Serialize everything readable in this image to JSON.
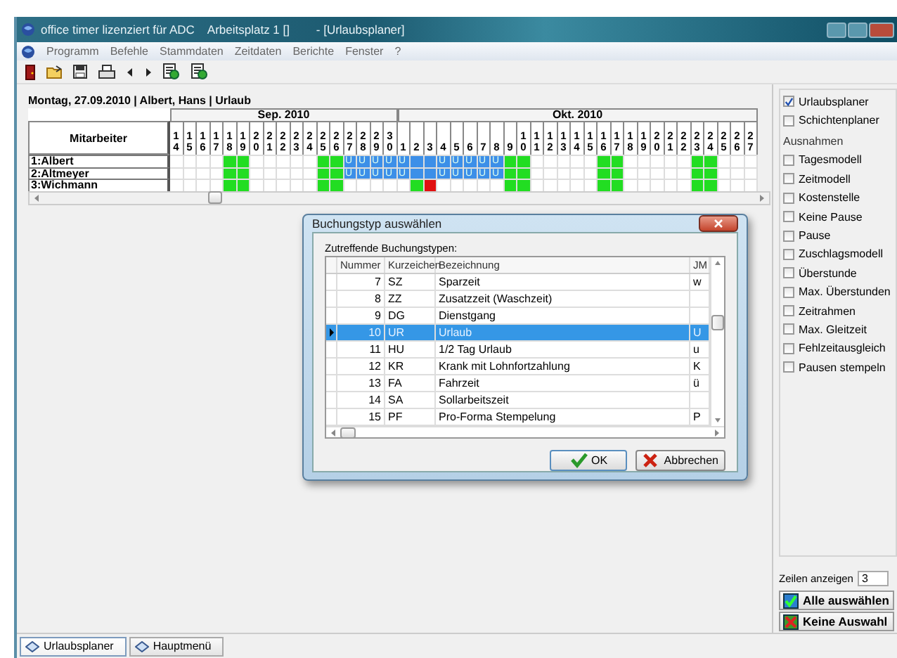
{
  "window": {
    "title": "office timer lizenziert für ADC    Arbeitsplatz 1 []        - [Urlaubsplaner]"
  },
  "menu": [
    "Programm",
    "Befehle",
    "Stammdaten",
    "Zeitdaten",
    "Berichte",
    "Fenster",
    "?"
  ],
  "planner": {
    "header": "Montag, 27.09.2010 | Albert, Hans | Urlaub",
    "employee_column": "Mitarbeiter",
    "months": [
      {
        "label": "Sep. 2010",
        "days": [
          "14",
          "15",
          "16",
          "17",
          "18",
          "19",
          "20",
          "21",
          "22",
          "23",
          "24",
          "25",
          "26",
          "27",
          "28",
          "29",
          "30"
        ]
      },
      {
        "label": "Okt. 2010",
        "days": [
          "1",
          "2",
          "3",
          "4",
          "5",
          "6",
          "7",
          "8",
          "9",
          "10",
          "11",
          "12",
          "13",
          "14",
          "15",
          "16",
          "17",
          "18",
          "19",
          "20",
          "21",
          "22",
          "23",
          "24",
          "25",
          "26",
          "27"
        ]
      }
    ],
    "rows": [
      {
        "name": "1:Albert",
        "cells": [
          {
            "kind": "empty"
          },
          {
            "kind": "empty"
          },
          {
            "kind": "empty"
          },
          {
            "kind": "empty"
          },
          {
            "kind": "weekend"
          },
          {
            "kind": "weekend"
          },
          {
            "kind": "empty"
          },
          {
            "kind": "empty"
          },
          {
            "kind": "empty"
          },
          {
            "kind": "empty"
          },
          {
            "kind": "empty"
          },
          {
            "kind": "weekend"
          },
          {
            "kind": "weekend"
          },
          {
            "kind": "vacation",
            "text": "U"
          },
          {
            "kind": "vacation",
            "text": "U"
          },
          {
            "kind": "vacation",
            "text": "U"
          },
          {
            "kind": "vacation",
            "text": "U"
          },
          {
            "kind": "vacation",
            "text": "U"
          },
          {
            "kind": "vacation"
          },
          {
            "kind": "vacation"
          },
          {
            "kind": "vacation",
            "text": "U"
          },
          {
            "kind": "vacation",
            "text": "U"
          },
          {
            "kind": "vacation",
            "text": "U"
          },
          {
            "kind": "vacation",
            "text": "U"
          },
          {
            "kind": "vacation",
            "text": "U"
          },
          {
            "kind": "weekend"
          },
          {
            "kind": "weekend"
          },
          {
            "kind": "empty"
          },
          {
            "kind": "empty"
          },
          {
            "kind": "empty"
          },
          {
            "kind": "empty"
          },
          {
            "kind": "empty"
          },
          {
            "kind": "weekend"
          },
          {
            "kind": "weekend"
          },
          {
            "kind": "empty"
          },
          {
            "kind": "empty"
          },
          {
            "kind": "empty"
          },
          {
            "kind": "empty"
          },
          {
            "kind": "empty"
          },
          {
            "kind": "weekend"
          },
          {
            "kind": "weekend"
          },
          {
            "kind": "empty"
          },
          {
            "kind": "empty"
          },
          {
            "kind": "empty"
          }
        ]
      },
      {
        "name": "2:Altmeyer",
        "cells": [
          {
            "kind": "empty"
          },
          {
            "kind": "empty"
          },
          {
            "kind": "empty"
          },
          {
            "kind": "empty"
          },
          {
            "kind": "weekend"
          },
          {
            "kind": "weekend"
          },
          {
            "kind": "empty"
          },
          {
            "kind": "empty"
          },
          {
            "kind": "empty"
          },
          {
            "kind": "empty"
          },
          {
            "kind": "empty"
          },
          {
            "kind": "weekend"
          },
          {
            "kind": "weekend"
          },
          {
            "kind": "vacation",
            "text": "U"
          },
          {
            "kind": "vacation",
            "text": "U"
          },
          {
            "kind": "vacation",
            "text": "U"
          },
          {
            "kind": "vacation",
            "text": "U"
          },
          {
            "kind": "vacation",
            "text": "U"
          },
          {
            "kind": "vacation"
          },
          {
            "kind": "vacation"
          },
          {
            "kind": "vacation",
            "text": "U"
          },
          {
            "kind": "vacation",
            "text": "U"
          },
          {
            "kind": "vacation",
            "text": "U"
          },
          {
            "kind": "vacation",
            "text": "U"
          },
          {
            "kind": "vacation",
            "text": "U"
          },
          {
            "kind": "weekend"
          },
          {
            "kind": "weekend"
          },
          {
            "kind": "empty"
          },
          {
            "kind": "empty"
          },
          {
            "kind": "empty"
          },
          {
            "kind": "empty"
          },
          {
            "kind": "empty"
          },
          {
            "kind": "weekend"
          },
          {
            "kind": "weekend"
          },
          {
            "kind": "empty"
          },
          {
            "kind": "empty"
          },
          {
            "kind": "empty"
          },
          {
            "kind": "empty"
          },
          {
            "kind": "empty"
          },
          {
            "kind": "weekend"
          },
          {
            "kind": "weekend"
          },
          {
            "kind": "empty"
          },
          {
            "kind": "empty"
          },
          {
            "kind": "empty"
          }
        ]
      },
      {
        "name": "3:Wichmann",
        "cells": [
          {
            "kind": "empty"
          },
          {
            "kind": "empty"
          },
          {
            "kind": "empty"
          },
          {
            "kind": "empty"
          },
          {
            "kind": "weekend"
          },
          {
            "kind": "weekend"
          },
          {
            "kind": "empty"
          },
          {
            "kind": "empty"
          },
          {
            "kind": "empty"
          },
          {
            "kind": "empty"
          },
          {
            "kind": "empty"
          },
          {
            "kind": "weekend"
          },
          {
            "kind": "weekend"
          },
          {
            "kind": "empty"
          },
          {
            "kind": "empty"
          },
          {
            "kind": "empty"
          },
          {
            "kind": "empty"
          },
          {
            "kind": "empty"
          },
          {
            "kind": "weekend"
          },
          {
            "kind": "flag"
          },
          {
            "kind": "empty"
          },
          {
            "kind": "empty"
          },
          {
            "kind": "empty"
          },
          {
            "kind": "empty"
          },
          {
            "kind": "empty"
          },
          {
            "kind": "weekend"
          },
          {
            "kind": "weekend"
          },
          {
            "kind": "empty"
          },
          {
            "kind": "empty"
          },
          {
            "kind": "empty"
          },
          {
            "kind": "empty"
          },
          {
            "kind": "empty"
          },
          {
            "kind": "weekend"
          },
          {
            "kind": "weekend"
          },
          {
            "kind": "empty"
          },
          {
            "kind": "empty"
          },
          {
            "kind": "empty"
          },
          {
            "kind": "empty"
          },
          {
            "kind": "empty"
          },
          {
            "kind": "weekend"
          },
          {
            "kind": "weekend"
          },
          {
            "kind": "empty"
          },
          {
            "kind": "empty"
          },
          {
            "kind": "empty"
          }
        ]
      }
    ]
  },
  "planners": [
    {
      "label": "Urlaubsplaner",
      "checked": true
    },
    {
      "label": "Schichtenplaner",
      "checked": false
    }
  ],
  "exceptions": {
    "label": "Ausnahmen",
    "items": [
      {
        "label": "Tagesmodell",
        "checked": false
      },
      {
        "label": "Zeitmodell",
        "checked": false
      },
      {
        "label": "Kostenstelle",
        "checked": false
      },
      {
        "label": "Keine Pause",
        "checked": false
      },
      {
        "label": "Pause",
        "checked": false
      },
      {
        "label": "Zuschlagsmodell",
        "checked": false
      },
      {
        "label": "Überstunde",
        "checked": false
      },
      {
        "label": "Max. Überstunden",
        "checked": false
      },
      {
        "label": "Zeitrahmen",
        "checked": false
      },
      {
        "label": "Max. Gleitzeit",
        "checked": false
      },
      {
        "label": "Fehlzeitausgleich",
        "checked": false
      },
      {
        "label": "Pausen stempeln",
        "checked": false
      }
    ]
  },
  "rows_shown": {
    "label": "Zeilen anzeigen",
    "value": "3"
  },
  "select_buttons": [
    {
      "label": "Alle auswählen",
      "kind": "all"
    },
    {
      "label": "Keine Auswahl",
      "kind": "none"
    }
  ],
  "dialog": {
    "title": "Buchungstyp auswählen",
    "list_label": "Zutreffende Buchungstypen:",
    "columns": [
      "Nummer",
      "Kurzeichen",
      "Bezeichnung",
      "JM"
    ],
    "rows": [
      {
        "number": "7",
        "code": "SZ",
        "name": "Sparzeit",
        "jm": "w",
        "selected": false
      },
      {
        "number": "8",
        "code": "ZZ",
        "name": "Zusatzzeit (Waschzeit)",
        "selected": false
      },
      {
        "number": "9",
        "code": "DG",
        "name": "Dienstgang",
        "selected": false
      },
      {
        "number": "10",
        "code": "UR",
        "name": "Urlaub",
        "jm": "U",
        "selected": true
      },
      {
        "number": "11",
        "code": "HU",
        "name": "1/2 Tag Urlaub",
        "jm": "u",
        "selected": false
      },
      {
        "number": "12",
        "code": "KR",
        "name": "Krank mit Lohnfortzahlung",
        "jm": "K",
        "selected": false
      },
      {
        "number": "13",
        "code": "FA",
        "name": "Fahrzeit",
        "jm": "ü",
        "selected": false
      },
      {
        "number": "14",
        "code": "SA",
        "name": "Sollarbeitszeit",
        "selected": false
      },
      {
        "number": "15",
        "code": "PF",
        "name": "Pro-Forma Stempelung",
        "jm": "P",
        "selected": false
      }
    ],
    "buttons": [
      {
        "label": "OK",
        "kind": "ok"
      },
      {
        "label": "Abbrechen",
        "kind": "cancel"
      }
    ]
  },
  "tabs": [
    {
      "label": "Urlaubsplaner",
      "selected": true
    },
    {
      "label": "Hauptmenü",
      "selected": false
    }
  ]
}
